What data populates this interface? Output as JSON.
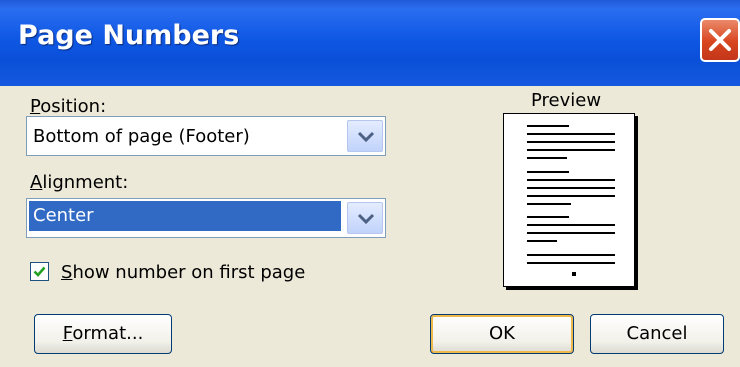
{
  "dialog": {
    "title": "Page Numbers",
    "close_label": "close"
  },
  "position": {
    "label": "Position:",
    "label_mnemonic": "P",
    "label_rest": "osition:",
    "value": "Bottom of page (Footer)"
  },
  "alignment": {
    "label_mnemonic": "A",
    "label_rest": "lignment:",
    "value": "Center"
  },
  "first_page": {
    "label_mnemonic": "S",
    "label_rest": "how number on first page",
    "checked": true
  },
  "preview": {
    "label": "Preview"
  },
  "buttons": {
    "format_mnemonic": "F",
    "format_rest": "ormat...",
    "ok": "OK",
    "cancel": "Cancel"
  },
  "colors": {
    "title_bar": "#0a4fd8",
    "close": "#d8451f",
    "selection": "#316ac5",
    "dialog_bg": "#ece9d8"
  }
}
